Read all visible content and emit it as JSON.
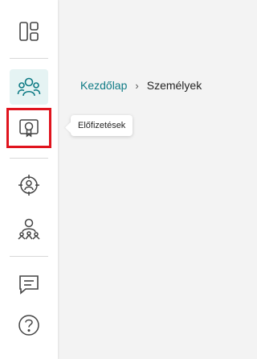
{
  "nav_rail": {
    "items": [
      {
        "name": "dashboard-icon",
        "selected": false
      },
      {
        "name": "people-icon",
        "selected": true
      },
      {
        "name": "subscriptions-icon",
        "selected": false
      },
      {
        "name": "target-person-icon",
        "selected": false
      },
      {
        "name": "network-person-icon",
        "selected": false
      },
      {
        "name": "chat-icon",
        "selected": false
      },
      {
        "name": "help-icon",
        "selected": false
      }
    ],
    "tooltip": "Előfizetések"
  },
  "breadcrumb": {
    "home": "Kezdőlap",
    "separator": "›",
    "current": "Személyek"
  },
  "colors": {
    "accent": "#0f7b85",
    "selected_bg": "#e5f3f3",
    "highlight_border": "#e0141e"
  }
}
